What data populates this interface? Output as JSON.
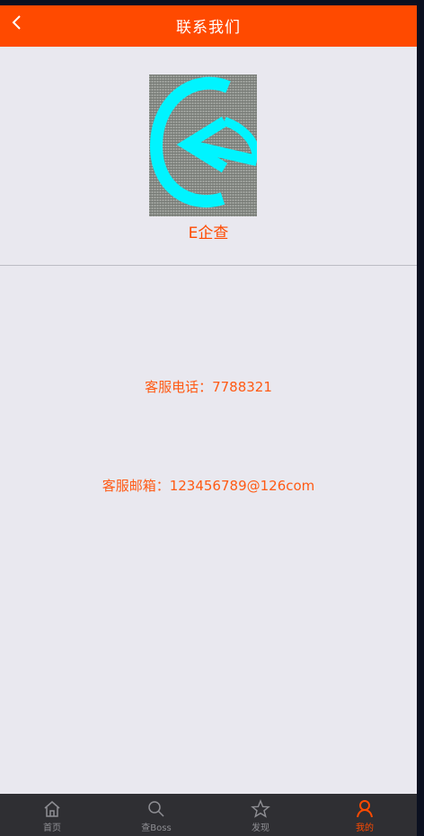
{
  "header": {
    "title": "联系我们",
    "back_icon": "chevron-left-icon"
  },
  "logo": {
    "name": "E企查",
    "colors": {
      "primary": "#00f0ff",
      "background": "#8a8d88"
    }
  },
  "contact": {
    "phone": "客服电话：7788321",
    "email": "客服邮箱：123456789@126com"
  },
  "bottom_nav": [
    {
      "label": "首页",
      "icon": "home-icon",
      "active": false
    },
    {
      "label": "查Boss",
      "icon": "search-icon",
      "active": false
    },
    {
      "label": "发现",
      "icon": "star-icon",
      "active": false
    },
    {
      "label": "我的",
      "icon": "person-icon",
      "active": true
    }
  ],
  "colors": {
    "accent": "#ff4a00",
    "page_background": "#e9e8ef",
    "nav_background": "#2f2f33",
    "nav_inactive": "#8f8f94"
  }
}
